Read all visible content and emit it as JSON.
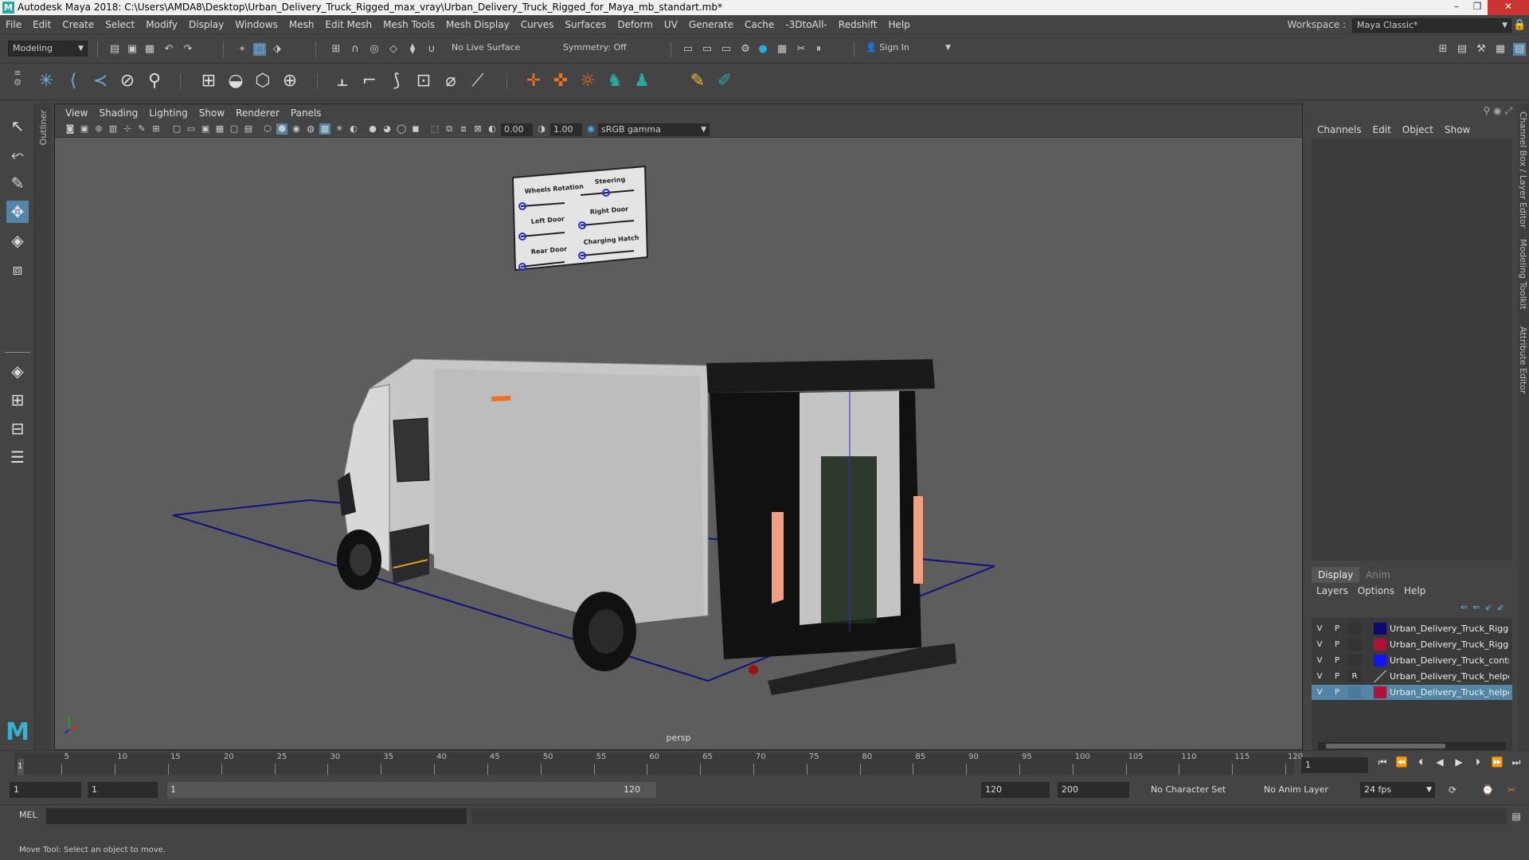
{
  "window": {
    "title": "Autodesk Maya 2018: C:\\Users\\AMDA8\\Desktop\\Urban_Delivery_Truck_Rigged_max_vray\\Urban_Delivery_Truck_Rigged_for_Maya_mb_standart.mb*",
    "controls": [
      "–",
      "❐",
      "✕"
    ]
  },
  "menu": [
    "File",
    "Edit",
    "Create",
    "Select",
    "Modify",
    "Display",
    "Windows",
    "Mesh",
    "Edit Mesh",
    "Mesh Tools",
    "Mesh Display",
    "Curves",
    "Surfaces",
    "Deform",
    "UV",
    "Generate",
    "Cache",
    "-3DtoAll-",
    "Redshift",
    "Help"
  ],
  "workspace": {
    "label": "Workspace :",
    "value": "Maya Classic*"
  },
  "statusline": {
    "mode": "Modeling",
    "live_surface": "No Live Surface",
    "symmetry": "Symmetry: Off",
    "sign_in": "Sign In"
  },
  "viewport": {
    "menus": [
      "View",
      "Shading",
      "Lighting",
      "Show",
      "Renderer",
      "Panels"
    ],
    "exposure": "0.00",
    "gamma": "1.00",
    "color_space": "sRGB gamma",
    "camera_label": "persp",
    "control_panel": {
      "labels": [
        "Wheels Rotation",
        "Steering",
        "Left Door",
        "Right Door",
        "Rear Door",
        "Charging Hatch"
      ]
    }
  },
  "left_tab": "Outliner",
  "right_side_tabs": [
    "Channel Box / Layer Editor",
    "Modeling Toolkit",
    "Attribute Editor"
  ],
  "channel_box": {
    "menus": [
      "Channels",
      "Edit",
      "Object",
      "Show"
    ]
  },
  "layer_editor": {
    "tabs": [
      "Display",
      "Anim"
    ],
    "menus": [
      "Layers",
      "Options",
      "Help"
    ],
    "layers": [
      {
        "v": "V",
        "p": "P",
        "r": "",
        "color": "#0a0a6a",
        "name": "Urban_Delivery_Truck_Rigged_",
        "selected": false
      },
      {
        "v": "V",
        "p": "P",
        "r": "",
        "color": "#b0103a",
        "name": "Urban_Delivery_Truck_Rigged_",
        "selected": false
      },
      {
        "v": "V",
        "p": "P",
        "r": "",
        "color": "#1515ee",
        "name": "Urban_Delivery_Truck_controll",
        "selected": false
      },
      {
        "v": "V",
        "p": "P",
        "r": "R",
        "color": "none",
        "name": "Urban_Delivery_Truck_helpers_",
        "selected": false
      },
      {
        "v": "V",
        "p": "P",
        "r": "",
        "color": "#b0103a",
        "name": "Urban_Delivery_Truck_helpers",
        "selected": true
      }
    ]
  },
  "timeline": {
    "ticks": [
      "5",
      "10",
      "15",
      "20",
      "25",
      "30",
      "35",
      "40",
      "45",
      "50",
      "55",
      "60",
      "65",
      "70",
      "75",
      "80",
      "85",
      "90",
      "95",
      "100",
      "105",
      "110",
      "115",
      "120"
    ],
    "current_frame_marker": "1",
    "current_frame": "1"
  },
  "range": {
    "start": "1",
    "playback_start": "1",
    "slider_start": "1",
    "slider_end": "120",
    "playback_end": "120",
    "end": "200",
    "character_set": "No Character Set",
    "anim_layer": "No Anim Layer",
    "fps": "24 fps"
  },
  "command_line": {
    "label": "MEL"
  },
  "help_line": "Move Tool: Select an object to move."
}
